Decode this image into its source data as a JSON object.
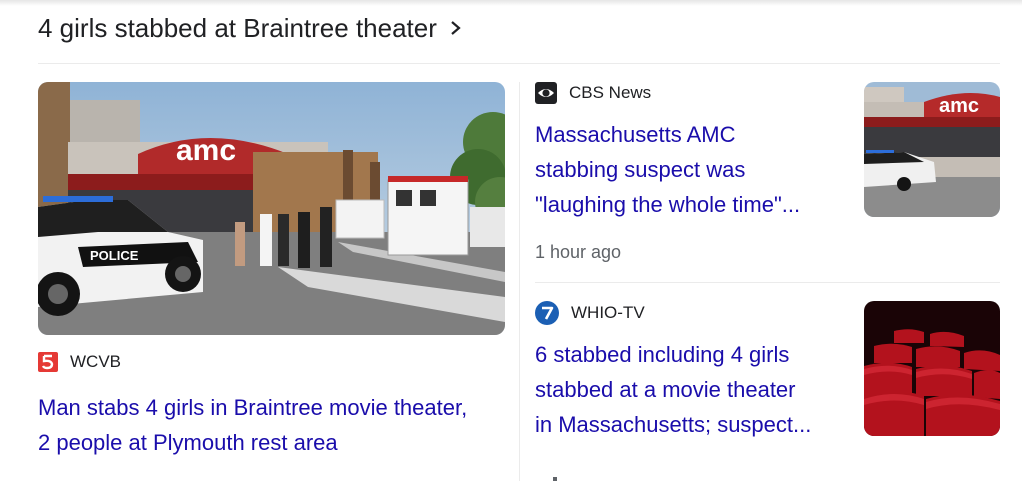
{
  "topic": {
    "title": "4 girls stabbed at Braintree theater",
    "chevron_icon": "chevron-right-icon"
  },
  "colors": {
    "link": "#1a0dab",
    "text": "#202124",
    "meta": "#5f6368",
    "wcvb_red": "#e53935",
    "whio_blue": "#1b5fb4"
  },
  "stories": [
    {
      "source": "WCVB",
      "logo_icon": "wcvb-5-logo-icon",
      "title_lines": [
        "Man stabs 4 girls in Braintree movie theater,",
        "2 people at Plymouth rest area"
      ],
      "image": "amc-theater-police-scene",
      "image_signage": "amc",
      "image_vehicle_text": "POLICE"
    },
    {
      "source": "CBS News",
      "logo_icon": "cbs-eye-logo-icon",
      "title_lines": [
        "Massachusetts AMC",
        "stabbing suspect was",
        "\"laughing the whole time\"..."
      ],
      "time": "1 hour ago",
      "image": "amc-theater-thumbnail",
      "image_signage": "amc"
    },
    {
      "source": "WHIO-TV",
      "logo_icon": "whio-7-logo-icon",
      "title_lines": [
        "6 stabbed including 4 girls",
        "stabbed at a movie theater",
        "in Massachusetts; suspect..."
      ],
      "image": "red-theater-seats-thumbnail"
    }
  ]
}
